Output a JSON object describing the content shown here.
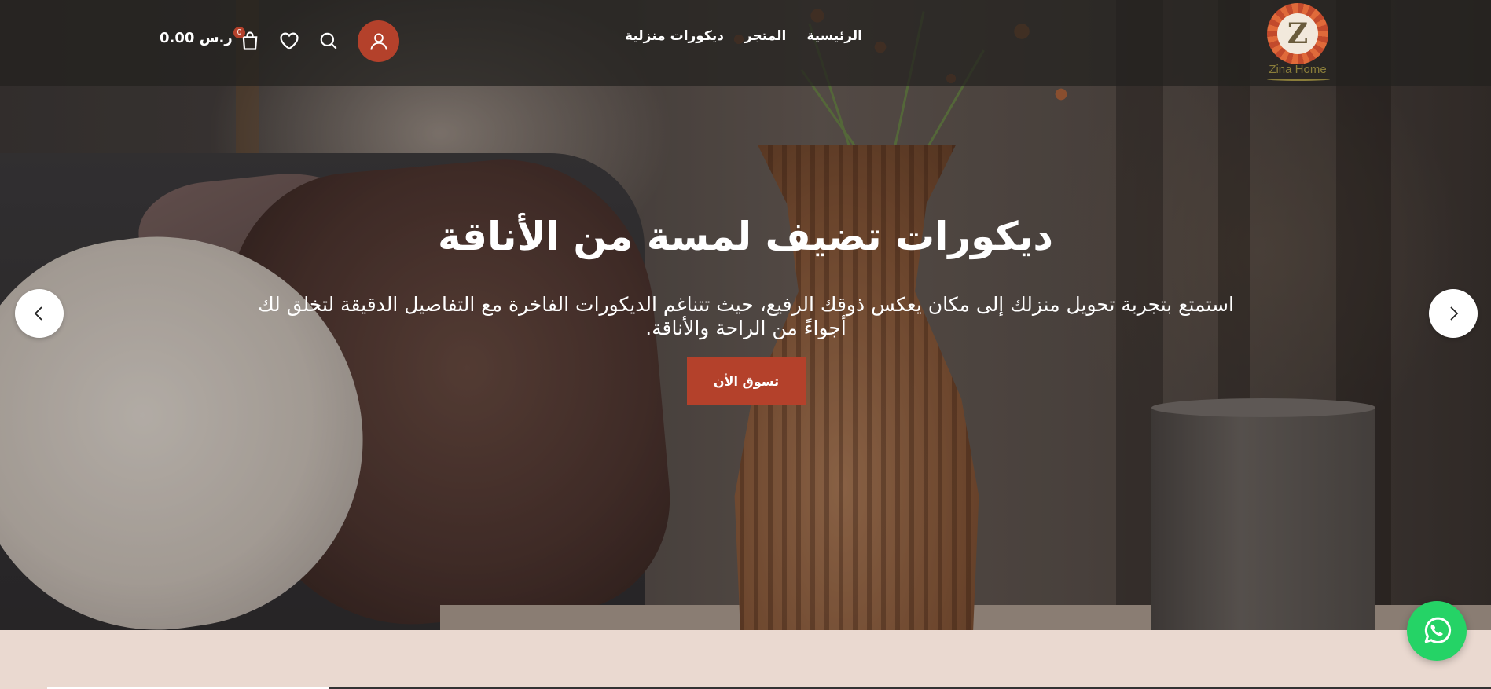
{
  "brand": {
    "logo_letter": "Z",
    "name": "Zina Home",
    "accent_color": "#b4412b"
  },
  "nav": {
    "items": [
      {
        "label": "الرئيسية"
      },
      {
        "label": "المتجر"
      },
      {
        "label": "ديكورات منزلية"
      }
    ]
  },
  "header_actions": {
    "account_icon": "user-icon",
    "search_icon": "search-icon",
    "wishlist_icon": "heart-icon",
    "cart_icon": "shopping-bag-icon",
    "cart_count": "0",
    "cart_total": "0.00 ر.س"
  },
  "hero": {
    "title": "ديكورات تضيف لمسة من الأناقة",
    "text": "استمتع بتجربة تحويل منزلك إلى مكان يعكس ذوقك الرفيع، حيث تتناغم الديكورات الفاخرة مع التفاصيل الدقيقة لتخلق لك أجواءً من الراحة والأناقة.",
    "cta_label": "تسوق الأن",
    "prev_icon": "chevron-left-icon",
    "next_icon": "chevron-right-icon"
  },
  "floating": {
    "whatsapp_icon": "whatsapp-icon",
    "whatsapp_color": "#25d366"
  }
}
